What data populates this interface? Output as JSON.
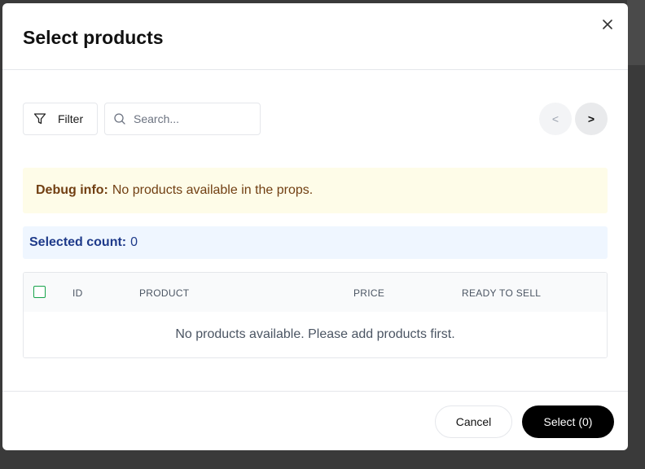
{
  "modal": {
    "title": "Select products",
    "close_icon": "close-icon"
  },
  "toolbar": {
    "filter_label": "Filter",
    "filter_icon": "filter-icon",
    "search_icon": "search-icon",
    "search_placeholder": "Search...",
    "search_value": "",
    "prev_label": "<",
    "next_label": ">"
  },
  "debug": {
    "label": "Debug info:",
    "message": "No products available in the props."
  },
  "selected": {
    "label": "Selected count:",
    "count": "0"
  },
  "table": {
    "columns": [
      "ID",
      "PRODUCT",
      "PRICE",
      "READY TO SELL"
    ],
    "select_all_checked": false,
    "empty_message": "No products available. Please add products first."
  },
  "footer": {
    "cancel_label": "Cancel",
    "select_label": "Select (0)"
  },
  "colors": {
    "debug_bg": "#fefce8",
    "debug_text": "#713f12",
    "count_bg": "#eff6ff",
    "count_text": "#1e3a8a",
    "primary_button": "#000000",
    "checkbox_border": "#16a34a"
  }
}
